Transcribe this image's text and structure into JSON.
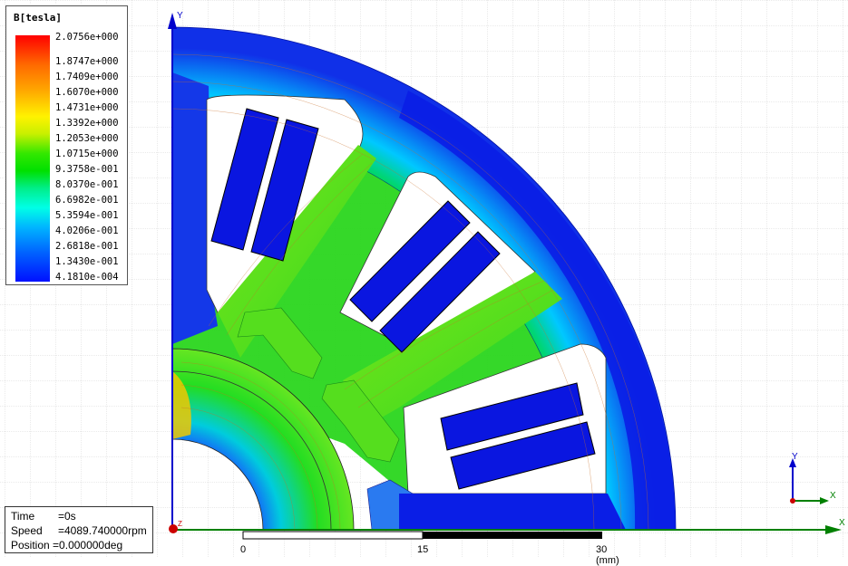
{
  "legend": {
    "title": "B[tesla]",
    "values": [
      "2.0756e+000",
      "1.8747e+000",
      "1.7409e+000",
      "1.6070e+000",
      "1.4731e+000",
      "1.3392e+000",
      "1.2053e+000",
      "1.0715e+000",
      "9.3758e-001",
      "8.0370e-001",
      "6.6982e-001",
      "5.3594e-001",
      "4.0206e-001",
      "2.6818e-001",
      "1.3430e-001",
      "4.1810e-004"
    ]
  },
  "status": {
    "time_label": "Time",
    "time_value": "=0s",
    "speed_label": "Speed",
    "speed_value": "=4089.740000rpm",
    "position_label": "Position",
    "position_value": "=0.000000deg"
  },
  "scale": {
    "tick_0": "0",
    "tick_1": "15",
    "tick_2": "30 (mm)"
  },
  "axes": {
    "y_label": "Y",
    "x_label": "X",
    "z_label": "Z",
    "mini_y": "Y",
    "mini_x": "X"
  },
  "colors": {
    "grid": "#d6d6d6",
    "axis_x": "#008000",
    "axis_y": "#0000cc",
    "origin": "#cc0000",
    "field_low": "#0a1ee6",
    "field_mid": "#2ad61e",
    "field_high": "#f0e600"
  }
}
